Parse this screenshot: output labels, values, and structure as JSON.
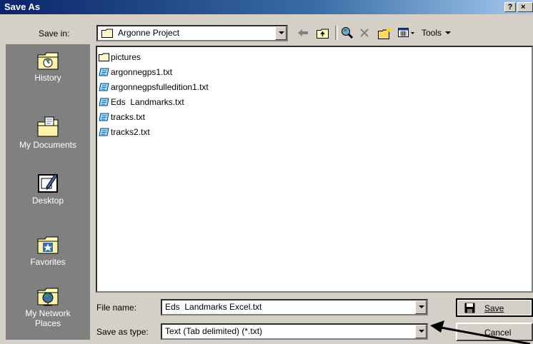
{
  "window": {
    "title": "Save As",
    "help_glyph": "?",
    "close_glyph": "×"
  },
  "toolbar": {
    "save_in_label": "Save in:",
    "current_folder": "Argonne Project",
    "tools_label": "Tools",
    "icons": [
      "back-arrow-icon",
      "up-one-level-icon",
      "search-web-icon",
      "delete-icon",
      "new-folder-icon",
      "views-icon",
      "tools-menu"
    ]
  },
  "places": [
    {
      "label": "History",
      "icon": "history-icon"
    },
    {
      "label": "My Documents",
      "icon": "my-documents-icon"
    },
    {
      "label": "Desktop",
      "icon": "desktop-icon"
    },
    {
      "label": "Favorites",
      "icon": "favorites-icon"
    },
    {
      "label": "My Network Places",
      "icon": "network-places-icon"
    }
  ],
  "files": [
    {
      "name": "pictures",
      "type": "folder"
    },
    {
      "name": "argonnegps1.txt",
      "type": "text"
    },
    {
      "name": "argonnegpsfulledition1.txt",
      "type": "text"
    },
    {
      "name": "Eds  Landmarks.txt",
      "type": "text"
    },
    {
      "name": "tracks.txt",
      "type": "text"
    },
    {
      "name": "tracks2.txt",
      "type": "text"
    }
  ],
  "bottom": {
    "file_name_label": "File name:",
    "file_name_value": "Eds  Landmarks Excel.txt",
    "save_as_type_label": "Save as type:",
    "save_as_type_value": "Text (Tab delimited) (*.txt)",
    "save_button": "Save",
    "cancel_button": "Cancel"
  }
}
